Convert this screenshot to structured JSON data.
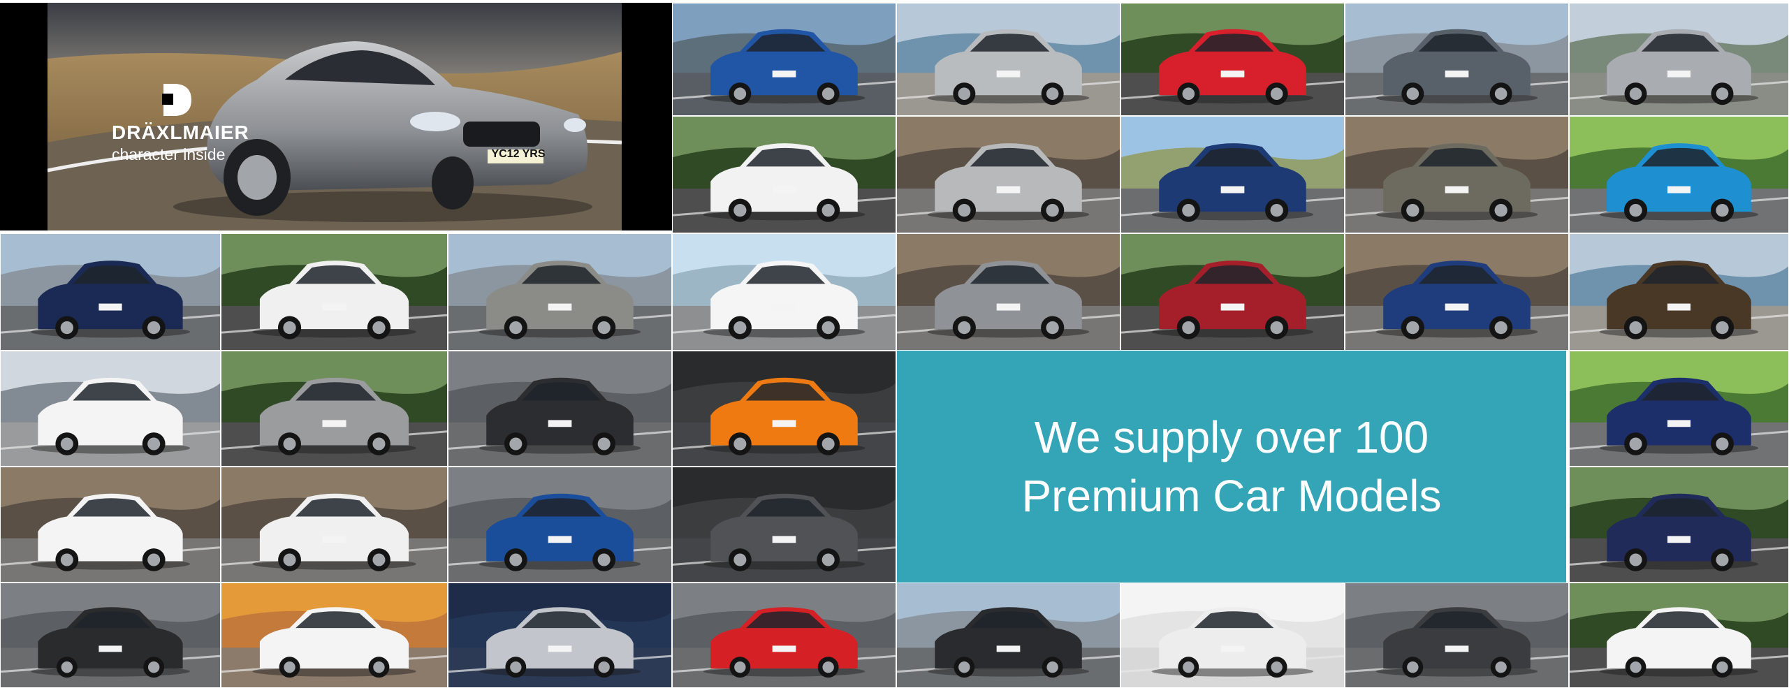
{
  "hero": {
    "brand_name": "DRÄXLMAIER",
    "brand_tagline": "character inside",
    "plate": "YC12 YRS"
  },
  "banner": {
    "line1": "We supply over 100",
    "line2": "Premium Car Models"
  },
  "colors": {
    "banner_teal": "#1296aa",
    "hero_background": "#000000"
  },
  "tiles": [
    {
      "body": "#2155a6",
      "bg": "sky-mountain"
    },
    {
      "body": "#b9bcbf",
      "bg": "sea"
    },
    {
      "body": "#d8202c",
      "bg": "forest"
    },
    {
      "body": "#58606a",
      "bg": "city"
    },
    {
      "body": "#a9adb1",
      "bg": "mountain"
    },
    {
      "body": "#f2f2f2",
      "bg": "forest"
    },
    {
      "body": "#b7b9bb",
      "bg": "building"
    },
    {
      "body": "#1e3a74",
      "bg": "sky-road"
    },
    {
      "body": "#6d6a60",
      "bg": "building"
    },
    {
      "body": "#1e8fd0",
      "bg": "grass"
    },
    {
      "body": "#1a2a55",
      "bg": "city"
    },
    {
      "body": "#f0f0f0",
      "bg": "forest"
    },
    {
      "body": "#8b8c88",
      "bg": "city"
    },
    {
      "body": "#f5f5f5",
      "bg": "sky"
    },
    {
      "body": "#8f9397",
      "bg": "building"
    },
    {
      "body": "#a51f2b",
      "bg": "forest"
    },
    {
      "body": "#1f3c7c",
      "bg": "building"
    },
    {
      "body": "#4a3826",
      "bg": "sea"
    },
    {
      "body": "#f4f4f4",
      "bg": "stadium"
    },
    {
      "body": "#9a9c9e",
      "bg": "forest"
    },
    {
      "body": "#2b2d30",
      "bg": "blur"
    },
    {
      "body": "#f07a12",
      "bg": "dark"
    },
    {
      "body": "#1d2f6b",
      "bg": "grass"
    },
    {
      "body": "#f4f4f4",
      "bg": "building"
    },
    {
      "body": "#f0f0f0",
      "bg": "building"
    },
    {
      "body": "#1b4e9a",
      "bg": "blur"
    },
    {
      "body": "#505255",
      "bg": "dark"
    },
    {
      "body": "#202b5a",
      "bg": "forest"
    },
    {
      "body": "#2a2b2d",
      "bg": "blur"
    },
    {
      "body": "#f4f4f4",
      "bg": "sunset"
    },
    {
      "body": "#c2c6cc",
      "bg": "dark-blue"
    },
    {
      "body": "#d52026",
      "bg": "blur"
    },
    {
      "body": "#2a2b2e",
      "bg": "city"
    },
    {
      "body": "#ededed",
      "bg": "white"
    },
    {
      "body": "#3a3c3f",
      "bg": "blur"
    },
    {
      "body": "#f4f4f4",
      "bg": "forest"
    }
  ]
}
